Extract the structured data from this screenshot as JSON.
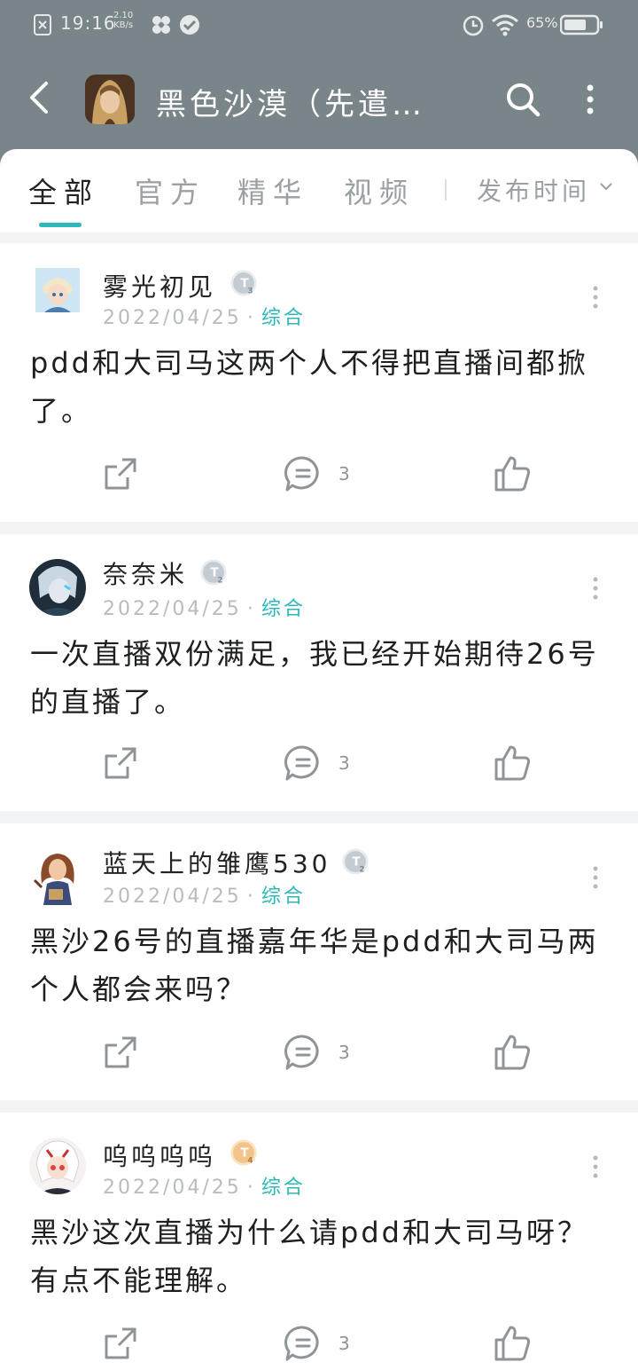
{
  "status_bar": {
    "time": "19:16",
    "net_speed_value": "2.10",
    "net_speed_unit": "KB/s",
    "battery": "65%"
  },
  "header": {
    "title": "黑色沙漠（先遣…"
  },
  "tabs": [
    {
      "label": "全部",
      "active": true
    },
    {
      "label": "官方",
      "active": false
    },
    {
      "label": "精华",
      "active": false
    },
    {
      "label": "视频",
      "active": false
    }
  ],
  "sort": {
    "label": "发布时间"
  },
  "posts": [
    {
      "username": "雾光初见",
      "badge": "T3",
      "date": "2022/04/25",
      "category": "综合",
      "content": "pdd和大司马这两个人不得把直播间都掀了。",
      "comments": "3"
    },
    {
      "username": "奈奈米",
      "badge": "T2",
      "date": "2022/04/25",
      "category": "综合",
      "content": "一次直播双份满足，我已经开始期待26号的直播了。",
      "comments": "3"
    },
    {
      "username": "蓝天上的雏鹰530",
      "badge": "T2",
      "date": "2022/04/25",
      "category": "综合",
      "content": "黑沙26号的直播嘉年华是pdd和大司马两个人都会来吗？",
      "comments": "3"
    },
    {
      "username": "呜呜呜呜",
      "badge": "T4",
      "date": "2022/04/25",
      "category": "综合",
      "content": "黑沙这次直播为什么请pdd和大司马呀？有点不能理解。",
      "comments": "3"
    }
  ],
  "colors": {
    "header_bg": "#7a8589",
    "accent": "#2bbab7",
    "badge_silver": "#b9c2ca",
    "badge_gold": "#f3c48a"
  }
}
